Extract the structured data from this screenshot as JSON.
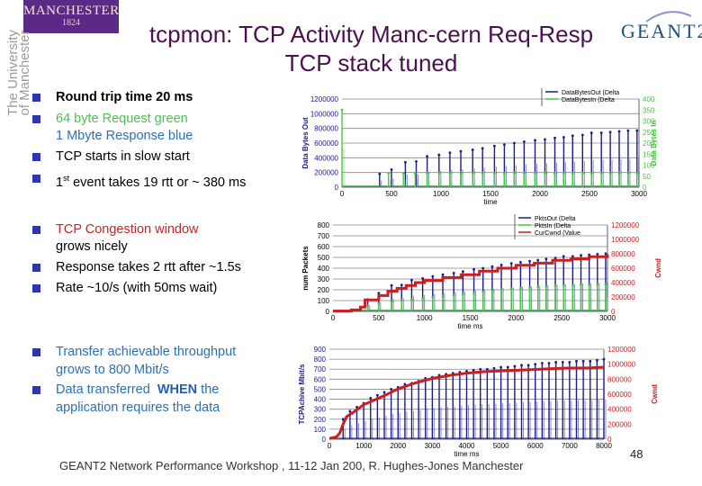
{
  "title": {
    "line1": "tcpmon: TCP Activity Manc-cern Req-Resp",
    "line2": "TCP stack tuned"
  },
  "logos": {
    "manchester_l1": "MANCHESTER",
    "manchester_l2": "1824",
    "university_l1": "The University",
    "university_l2": "of Manchester",
    "geant": "GEANT2"
  },
  "bullets": {
    "group1": [
      {
        "text": "Round trip time 20 ms",
        "color": "#000000",
        "bold": true
      },
      {
        "text": "64 byte Request green",
        "color": "#4cc24c",
        "cont": "1 Mbyte Response blue",
        "cont_color": "#2d6fb0"
      },
      {
        "text": "TCP starts in slow start",
        "color": "#000000"
      },
      {
        "text_pre": "1",
        "sup": "st",
        "text": " event takes 19 rtt or ~ 380 ms",
        "color": "#000000"
      }
    ],
    "group2": [
      {
        "text": "TCP Congestion window",
        "color": "#c0282d",
        "cont": "grows nicely",
        "cont_color": "#000000"
      },
      {
        "text": "Response takes 2 rtt after ~1.5s",
        "color": "#000000"
      },
      {
        "text": "Rate ~10/s (with 50ms wait)",
        "color": "#000000"
      }
    ],
    "group3": [
      {
        "text": "Transfer achievable throughput",
        "color": "#2d6fb0",
        "cont": "grows to 800 Mbit/s",
        "cont_color": "#2d6fb0"
      },
      {
        "text_pre": "Data transferred  ",
        "strong": "WHEN",
        "text": " the",
        "color": "#2d6fb0",
        "cont": "application requires the data",
        "cont_color": "#2d6fb0"
      }
    ],
    "bullet_color": "#2f35b0"
  },
  "footer": "GEANT2 Network Performance Workshop , 11-12 Jan 200,  R. Hughes-Jones  Manchester",
  "page_number": "48",
  "chart_data": [
    {
      "type": "line",
      "title": "",
      "xlabel": "time",
      "ylabel": "Data Bytes Out",
      "y2label": "Data Bytes In",
      "xlim": [
        0,
        3000
      ],
      "ylim": [
        0,
        1200000
      ],
      "y2lim": [
        0,
        400
      ],
      "x_ticks": [
        "0",
        "500",
        "1000",
        "1500",
        "2000",
        "2500",
        "3000"
      ],
      "y_ticks": [
        "0",
        "200000",
        "400000",
        "600000",
        "800000",
        "1000000",
        "1200000"
      ],
      "y2_ticks": [
        "0",
        "50",
        "100",
        "150",
        "200",
        "250",
        "300",
        "350",
        "400"
      ],
      "grid": true,
      "legend": "top-right",
      "series": [
        {
          "name": "DataBytesOut (Delta",
          "color": "#1a1a8c",
          "axis": "left",
          "style": "spikes",
          "peaks_x": [
            380,
            500,
            640,
            750,
            860,
            980,
            1090,
            1200,
            1320,
            1420,
            1540,
            1640,
            1740,
            1840,
            1950,
            2050,
            2150,
            2240,
            2330,
            2430,
            2520,
            2620,
            2710,
            2800,
            2890,
            2980
          ],
          "peaks_y": [
            180000,
            240000,
            340000,
            350000,
            420000,
            440000,
            470000,
            490000,
            510000,
            530000,
            560000,
            580000,
            600000,
            620000,
            640000,
            650000,
            670000,
            680000,
            700000,
            710000,
            740000,
            740000,
            750000,
            760000,
            770000,
            770000
          ]
        },
        {
          "name": "DataBytesIn (Delta",
          "color": "#44c83c",
          "axis": "right",
          "style": "spikes",
          "peaks_x": [
            0,
            470,
            620,
            740,
            860,
            980,
            1090,
            1200,
            1320,
            1420,
            1540,
            1640,
            1740,
            1840,
            1950,
            2050,
            2150,
            2240,
            2330,
            2430,
            2520,
            2620,
            2710,
            2800,
            2890,
            2980
          ],
          "peaks_y": [
            350,
            64,
            64,
            64,
            64,
            64,
            64,
            64,
            64,
            64,
            64,
            64,
            64,
            64,
            64,
            64,
            64,
            64,
            64,
            64,
            64,
            64,
            64,
            64,
            64,
            64
          ]
        }
      ]
    },
    {
      "type": "line",
      "title": "",
      "xlabel": "time ms",
      "ylabel": "num Packets",
      "y2label": "Cwnd",
      "xlim": [
        0,
        3000
      ],
      "ylim": [
        0,
        800
      ],
      "y2lim": [
        0,
        1200000
      ],
      "x_ticks": [
        "0",
        "500",
        "1000",
        "1500",
        "2000",
        "2500",
        "3000"
      ],
      "y_ticks": [
        "0",
        "100",
        "200",
        "300",
        "400",
        "500",
        "600",
        "700",
        "800"
      ],
      "y2_ticks": [
        "0",
        "200000",
        "400000",
        "600000",
        "800000",
        "1000000",
        "1200000"
      ],
      "grid": true,
      "legend": "top-right",
      "series": [
        {
          "name": "PktsOut (Delta",
          "color": "#1a1a8c",
          "axis": "left",
          "style": "spikes",
          "peaks_x": [
            380,
            500,
            640,
            750,
            860,
            980,
            1090,
            1200,
            1320,
            1420,
            1540,
            1640,
            1740,
            1840,
            1950,
            2050,
            2150,
            2240,
            2330,
            2430,
            2520,
            2620,
            2710,
            2800,
            2890,
            2980
          ],
          "peaks_y": [
            110,
            170,
            240,
            245,
            290,
            305,
            325,
            340,
            355,
            370,
            390,
            400,
            415,
            430,
            445,
            455,
            465,
            475,
            485,
            495,
            510,
            510,
            520,
            525,
            530,
            535
          ]
        },
        {
          "name": "PktsIn (Delta",
          "color": "#44c83c",
          "axis": "left",
          "style": "spikes",
          "peaks_x": [
            380,
            500,
            640,
            750,
            860,
            980,
            1090,
            1200,
            1320,
            1420,
            1540,
            1640,
            1740,
            1840,
            1950,
            2050,
            2150,
            2240,
            2330,
            2430,
            2520,
            2620,
            2710,
            2800,
            2890,
            2980
          ],
          "peaks_y": [
            50,
            70,
            90,
            100,
            110,
            120,
            130,
            140,
            150,
            160,
            170,
            180,
            190,
            200,
            210,
            215,
            220,
            225,
            230,
            235,
            240,
            240,
            245,
            245,
            250,
            250
          ]
        },
        {
          "name": "CurCwnd (Value",
          "color": "#cc1e1e",
          "axis": "right",
          "style": "step",
          "x": [
            0,
            200,
            300,
            350,
            500,
            600,
            700,
            800,
            900,
            1000,
            1200,
            1400,
            1600,
            1800,
            2000,
            2200,
            2400,
            2600,
            2800,
            3000
          ],
          "y": [
            5000,
            20000,
            60000,
            160000,
            220000,
            280000,
            320000,
            360000,
            400000,
            430000,
            470000,
            510000,
            560000,
            600000,
            640000,
            670000,
            710000,
            730000,
            760000,
            790000
          ]
        }
      ]
    },
    {
      "type": "line",
      "title": "",
      "xlabel": "time ms",
      "ylabel": "TCPAchive Mbit/s",
      "y2label": "Cwnd",
      "xlim": [
        0,
        8000
      ],
      "ylim": [
        0,
        900
      ],
      "y2lim": [
        0,
        1200000
      ],
      "x_ticks": [
        "0",
        "1000",
        "2000",
        "3000",
        "4000",
        "5000",
        "6000",
        "7000",
        "8000"
      ],
      "y_ticks": [
        "0",
        "100",
        "200",
        "300",
        "400",
        "500",
        "600",
        "700",
        "800",
        "900"
      ],
      "y2_ticks": [
        "0",
        "200000",
        "400000",
        "600000",
        "800000",
        "1000000",
        "1200000"
      ],
      "grid": true,
      "legend": "none",
      "series": [
        {
          "name": "TCPAchive Mbit/s",
          "color": "#1a1a8c",
          "axis": "left",
          "style": "spikes",
          "peaks_x": [
            400,
            600,
            800,
            1000,
            1200,
            1400,
            1600,
            1800,
            2000,
            2200,
            2400,
            2600,
            2800,
            3000,
            3200,
            3400,
            3600,
            3800,
            4000,
            4200,
            4400,
            4600,
            4800,
            5000,
            5200,
            5400,
            5600,
            5800,
            6000,
            6200,
            6400,
            6600,
            6800,
            7000,
            7200,
            7400,
            7600,
            7800,
            8000
          ],
          "peaks_y": [
            200,
            280,
            320,
            360,
            410,
            440,
            470,
            500,
            520,
            550,
            560,
            580,
            610,
            620,
            640,
            650,
            660,
            670,
            680,
            690,
            700,
            700,
            710,
            720,
            720,
            730,
            740,
            740,
            750,
            760,
            760,
            770,
            770,
            770,
            780,
            780,
            780,
            790,
            800
          ]
        },
        {
          "name": "Cwnd",
          "color": "#cc1e1e",
          "axis": "right",
          "style": "line",
          "x": [
            0,
            200,
            300,
            400,
            500,
            700,
            1000,
            1300,
            1600,
            2000,
            2500,
            3000,
            3500,
            4000,
            4500,
            5000,
            5500,
            6000,
            6500,
            7000,
            7500,
            8000
          ],
          "y": [
            10000,
            30000,
            80000,
            200000,
            300000,
            360000,
            460000,
            520000,
            580000,
            670000,
            750000,
            810000,
            850000,
            880000,
            900000,
            910000,
            920000,
            930000,
            940000,
            950000,
            950000,
            960000
          ]
        }
      ]
    }
  ]
}
